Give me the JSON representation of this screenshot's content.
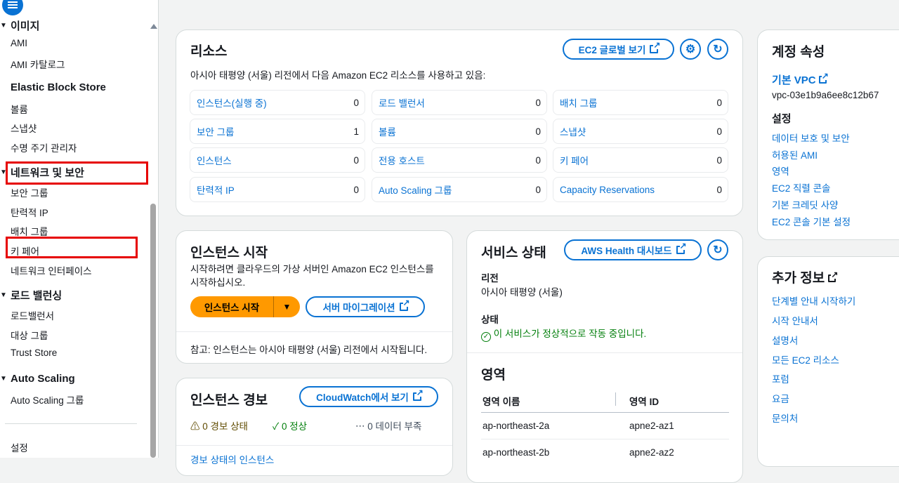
{
  "sidebar": {
    "sections": [
      {
        "title": "이미지",
        "items": [
          "AMI",
          "AMI 카탈로그"
        ]
      },
      {
        "title": "Elastic Block Store",
        "items": [
          "볼륨",
          "스냅샷",
          "수명 주기 관리자"
        ]
      },
      {
        "title": "네트워크 및 보안",
        "items": [
          "보안 그룹",
          "탄력적 IP",
          "배치 그룹",
          "키 페어",
          "네트워크 인터페이스"
        ]
      },
      {
        "title": "로드 밸런싱",
        "items": [
          "로드밸런서",
          "대상 그룹",
          "Trust Store"
        ]
      },
      {
        "title": "Auto Scaling",
        "items": [
          "Auto Scaling 그룹"
        ]
      }
    ],
    "settings": "설정"
  },
  "resources": {
    "title": "리소스",
    "global_view": "EC2 글로벌 보기",
    "subtitle": "아시아 태평양 (서울) 리전에서 다음 Amazon EC2 리소스를 사용하고 있음:",
    "cells": [
      {
        "label": "인스턴스(실행 중)",
        "count": "0"
      },
      {
        "label": "로드 밸런서",
        "count": "0"
      },
      {
        "label": "배치 그룹",
        "count": "0"
      },
      {
        "label": "보안 그룹",
        "count": "1"
      },
      {
        "label": "볼륨",
        "count": "0"
      },
      {
        "label": "스냅샷",
        "count": "0"
      },
      {
        "label": "인스턴스",
        "count": "0"
      },
      {
        "label": "전용 호스트",
        "count": "0"
      },
      {
        "label": "키 페어",
        "count": "0"
      },
      {
        "label": "탄력적 IP",
        "count": "0"
      },
      {
        "label": "Auto Scaling 그룹",
        "count": "0"
      },
      {
        "label": "Capacity Reservations",
        "count": "0"
      }
    ]
  },
  "launch": {
    "title": "인스턴스 시작",
    "desc1": "시작하려면 클라우드의 가상 서버인 Amazon EC2 인스턴스를",
    "desc2": "시작하십시오.",
    "launch_btn": "인스턴스 시작",
    "migrate_btn": "서버 마이그레이션",
    "note": "참고: 인스턴스는 아시아 태평양 (서울) 리전에서 시작됩니다."
  },
  "alarms": {
    "title": "인스턴스 경보",
    "cw_btn": "CloudWatch에서 보기",
    "alarm": "0 경보 상태",
    "ok": "0 정상",
    "insufficient": "0 데이터 부족",
    "footer": "경보 상태의 인스턴스"
  },
  "service": {
    "title": "서비스 상태",
    "health_btn": "AWS Health 대시보드",
    "region_label": "리전",
    "region_value": "아시아 태평양 (서울)",
    "status_label": "상태",
    "status_value": "이 서비스가 정상적으로 작동 중입니다."
  },
  "zones": {
    "title": "영역",
    "col_name": "영역 이름",
    "col_id": "영역 ID",
    "rows": [
      {
        "name": "ap-northeast-2a",
        "id": "apne2-az1"
      },
      {
        "name": "ap-northeast-2b",
        "id": "apne2-az2"
      }
    ]
  },
  "account": {
    "title": "계정 속성",
    "vpc_label": "기본 VPC",
    "vpc_id": "vpc-03e1b9a6ee8c12b67",
    "settings_title": "설정",
    "links": [
      "데이터 보호 및 보안",
      "허용된 AMI",
      "영역",
      "EC2 직렬 콘솔",
      "기본 크레딧 사양",
      "EC2 콘솔 기본 설정"
    ]
  },
  "more": {
    "title": "추가 정보",
    "links": [
      "단계별 안내 시작하기",
      "시작 안내서",
      "설명서",
      "모든 EC2 리소스",
      "포럼",
      "요금",
      "문의처"
    ]
  },
  "colors": {
    "accent": "#0972d3",
    "launch": "#ff9900",
    "success": "#037f0c",
    "highlight": "#e60000"
  }
}
